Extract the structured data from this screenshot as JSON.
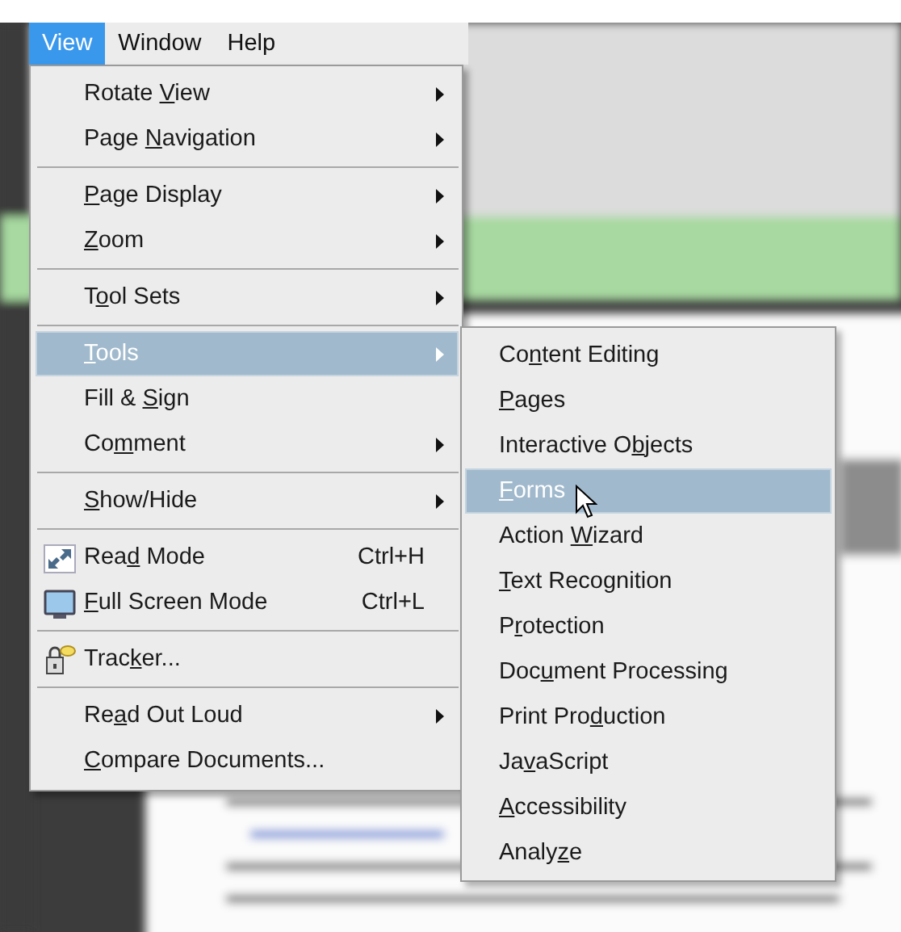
{
  "menu_bar": [
    {
      "label": "View",
      "selected": true
    },
    {
      "label": "Window",
      "selected": false
    },
    {
      "label": "Help",
      "selected": false
    }
  ],
  "view_menu": {
    "sections": [
      [
        {
          "label": {
            "before": "Rotate ",
            "key": "V",
            "after": "iew"
          },
          "submenu": true,
          "selected": false
        },
        {
          "label": {
            "before": "Page ",
            "key": "N",
            "after": "avigation"
          },
          "submenu": true,
          "selected": false
        }
      ],
      [
        {
          "label": {
            "key": "P",
            "after": "age Display"
          },
          "submenu": true,
          "selected": false
        },
        {
          "label": {
            "key": "Z",
            "after": "oom"
          },
          "submenu": true,
          "selected": false
        }
      ],
      [
        {
          "label": {
            "before": "T",
            "key": "o",
            "after": "ol Sets"
          },
          "submenu": true,
          "selected": false
        }
      ],
      [
        {
          "label": {
            "key": "T",
            "after": "ools"
          },
          "submenu": true,
          "selected": true
        },
        {
          "label": {
            "before": "Fill & ",
            "key": "S",
            "after": "ign"
          },
          "submenu": false,
          "selected": false
        },
        {
          "label": {
            "before": "Co",
            "key": "m",
            "after": "ment"
          },
          "submenu": true,
          "selected": false
        }
      ],
      [
        {
          "label": {
            "key": "S",
            "after": "how/Hide"
          },
          "submenu": true,
          "selected": false
        }
      ],
      [
        {
          "label": {
            "before": "Rea",
            "key": "d",
            "after": " Mode"
          },
          "shortcut": "Ctrl+H",
          "submenu": false,
          "selected": false
        },
        {
          "label": {
            "key": "F",
            "after": "ull Screen Mode"
          },
          "shortcut": "Ctrl+L",
          "submenu": false,
          "selected": false
        }
      ],
      [
        {
          "label": {
            "before": "Trac",
            "key": "k",
            "after": "er..."
          },
          "submenu": false,
          "selected": false
        }
      ],
      [
        {
          "label": {
            "before": "Re",
            "key": "a",
            "after": "d Out Loud"
          },
          "submenu": true,
          "selected": false
        },
        {
          "label": {
            "key": "C",
            "after": "ompare Documents..."
          },
          "submenu": false,
          "selected": false
        }
      ]
    ]
  },
  "tools_submenu": [
    {
      "label": {
        "before": "Co",
        "key": "n",
        "after": "tent Editing"
      },
      "selected": false
    },
    {
      "label": {
        "key": "P",
        "after": "ages"
      },
      "selected": false
    },
    {
      "label": {
        "before": "Interactive O",
        "key": "b",
        "after": "jects"
      },
      "selected": false
    },
    {
      "label": {
        "key": "F",
        "after": "orms"
      },
      "selected": true
    },
    {
      "label": {
        "before": "Action ",
        "key": "W",
        "after": "izard"
      },
      "selected": false
    },
    {
      "label": {
        "key": "T",
        "after": "ext Recognition"
      },
      "selected": false
    },
    {
      "label": {
        "before": "P",
        "key": "r",
        "after": "otection"
      },
      "selected": false
    },
    {
      "label": {
        "before": "Doc",
        "key": "u",
        "after": "ment Processing"
      },
      "selected": false
    },
    {
      "label": {
        "before": "Print Pro",
        "key": "d",
        "after": "uction"
      },
      "selected": false
    },
    {
      "label": {
        "before": "Ja",
        "key": "v",
        "after": "aScript"
      },
      "selected": false
    },
    {
      "label": {
        "key": "A",
        "after": "ccessibility"
      },
      "selected": false
    },
    {
      "label": {
        "before": "Analy",
        "key": "z",
        "after": "e"
      },
      "selected": false
    }
  ]
}
